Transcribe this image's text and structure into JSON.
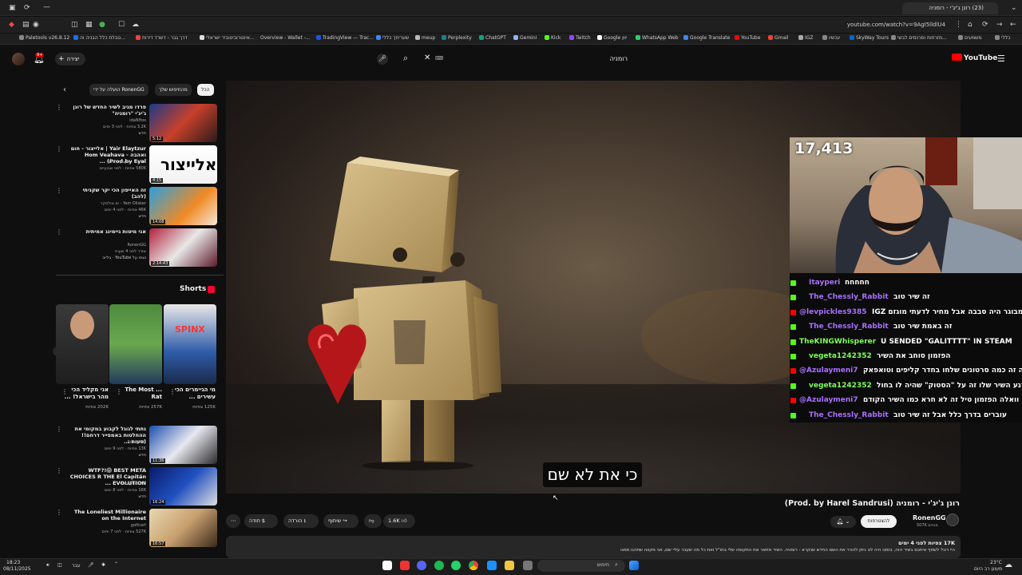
{
  "browser": {
    "tab_title": "(23) רונן ג'יג'י - רומניה",
    "url": "youtube.com/watch?v=9AgI5lldlU4",
    "bookmarks": [
      "Paletools v26.8.12",
      "טבלת כלל הבניה וה...",
      "דרך גבר - דשרד דירות",
      "אינטרוביטוביר ישראלי...",
      "Overview - Wallet -...",
      "TradingView — Trac...",
      "שעריחך כללי",
      "meup",
      "Perplexity",
      "ChatGPT",
      "Gemini",
      "Kick",
      "Twitch",
      "Google יוון",
      "WhatsApp Web",
      "Google Translate",
      "YouTube",
      "Gmail",
      "IGZ",
      "עכשיו",
      "SkyWay Tours",
      "מזרחות ומרנסים לבשי...",
      "משמעים",
      "כללי"
    ]
  },
  "header": {
    "create_label": "יצירה",
    "search_query": "רומניה",
    "logo_text": "YouTube",
    "notification_count": "9+"
  },
  "sidebar": {
    "chips": [
      "הכל",
      "מהחיפוש שלך",
      "הועלה על ידי RonenGG"
    ],
    "related": [
      {
        "title": "פרדו מגיב לשיר החדש של רונן ג'יג'י \"רומניה\"",
        "channel": "idaNHos",
        "meta": "3.2K צפיות · לפני 3 ימים",
        "badge": "חדש",
        "duration": "5:12"
      },
      {
        "title": "Yair Elaytzur | אלייצור - חום ואהבה - Hom Veahava (Prod.by Eyal ...",
        "channel": "אלייצור - הערוץ הרשמי",
        "meta": "580K צפיות · לפני שבועיים",
        "badge": "",
        "duration": "4:15"
      },
      {
        "title": "זה האייפון הכי יקר שקניתי (להב)",
        "channel": "Yam Olisker - ים אולסקר",
        "meta": "46K צפיות · לפני 4 ימים",
        "badge": "חדש",
        "duration": "14:08"
      },
      {
        "title": "אני מיטות גיימינג אמיתית",
        "channel": "RonenGG",
        "meta": "שודר לפני 4 שעות",
        "badge": "נצפו על YouTube · בלייב",
        "duration": "2:14:43"
      }
    ],
    "shorts_title": "Shorts",
    "shorts": [
      {
        "title": "מי הגיימרים הכי עשירים ...",
        "views": "125K צפיות"
      },
      {
        "title": "The Most ... Rat",
        "views": "257K צפיות"
      },
      {
        "title": "אני מקליד הכי מהר בישראל! ...",
        "views": "202K צפיות"
      }
    ],
    "related2": [
      {
        "title": "נתתי לגוגל לקבוע במקומי את ההחלטות באמפייר דרחם!! (טעות ...",
        "channel": "RonenGG",
        "meta": "13K צפיות · לפני 9 ימים",
        "badge": "חדש",
        "duration": "11:36"
      },
      {
        "title": "WTF?!😱 BEST META CHOICES R THE El Capitán EVOLUTION ...",
        "channel": "Inception FC",
        "meta": "16K צפיות · לפני 8 ימים",
        "badge": "חדש",
        "duration": "16:24"
      },
      {
        "title": "The Loneliest Millionaire on the Internet",
        "channel": "golfcart",
        "meta": "527K צפיות · לפני 7 ימים",
        "badge": "",
        "duration": "16:57"
      }
    ]
  },
  "player": {
    "subtitle": "כי את לא שם",
    "viewer_count": "17,413"
  },
  "chat": [
    {
      "user": "Itayperi",
      "msg": "חחחחח",
      "color": "#a970ff"
    },
    {
      "user": "The_Chessly_Rabbit",
      "msg": "זה שיר טוב",
      "color": "#a970ff"
    },
    {
      "user": "@levpickles9385",
      "msg": "IGZ במבוגר היה סבבה אבל מחיר לדעתי מוגזם",
      "color": "#a970ff"
    },
    {
      "user": "The_Chessly_Rabbit",
      "msg": "זה באמת שיר טוב",
      "color": "#a970ff"
    },
    {
      "user": "TheKINGWhisperer",
      "msg": "U SENDED \"GALITTTT\" IN STEAM",
      "color": "#7fff5a"
    },
    {
      "user": "vegeta1242352",
      "msg": "הפזמון סוחב את השיר",
      "color": "#7fff5a"
    },
    {
      "user": "@Azulaymeni7",
      "msg": "מה זה כמה סרטונים שלחו בחדר קליפים וטואפאק",
      "color": "#a970ff"
    },
    {
      "user": "vegeta1242352",
      "msg": "רגע השיר שלו זה על \"הסטוק\" שהיה לו בחול?",
      "color": "#7fff5a"
    },
    {
      "user": "@Azulaymeni7",
      "msg": "וואלה הפזמון טיל זה לא חרא כמו השיר הקודם",
      "color": "#a970ff"
    },
    {
      "user": "The_Chessly_Rabbit",
      "msg": "עוברים בדרך כלל אבל זה שיר טוב",
      "color": "#a970ff"
    }
  ],
  "video": {
    "title": "רונן ג'יג'י - רומניה (Prod. by Harel Sandrusi)",
    "channel": "RonenGG",
    "subscribers": "507K מנויים",
    "subscribe_label": "להצטרפות",
    "like_count": "1.6K",
    "share_label": "שיתוף",
    "download_label": "הורדה",
    "thanks_label": "תודה",
    "views_meta": "17K צפיות  לפני 4 ימים",
    "description": "היי רוני! לשתף איתכם בשיר הזה, בזמנו היה לנו ניתן להכיר את השם החדש שנקרא - רומניה. השיר מתאר את התקופה שלי בחו\"ל ואת כל מה שעבר עליי שם, אני מקווה שתהנו ממנו"
  },
  "taskbar": {
    "search_placeholder": "חיפוש",
    "time": "18:23",
    "date": "08/11/2025",
    "weather": "23°C",
    "weather_desc": "מעונן רב היום",
    "lang": "עבר"
  },
  "colors": {
    "accent": "#ff0000",
    "kick_green": "#53fc18",
    "youtube_red": "#ff0033"
  }
}
